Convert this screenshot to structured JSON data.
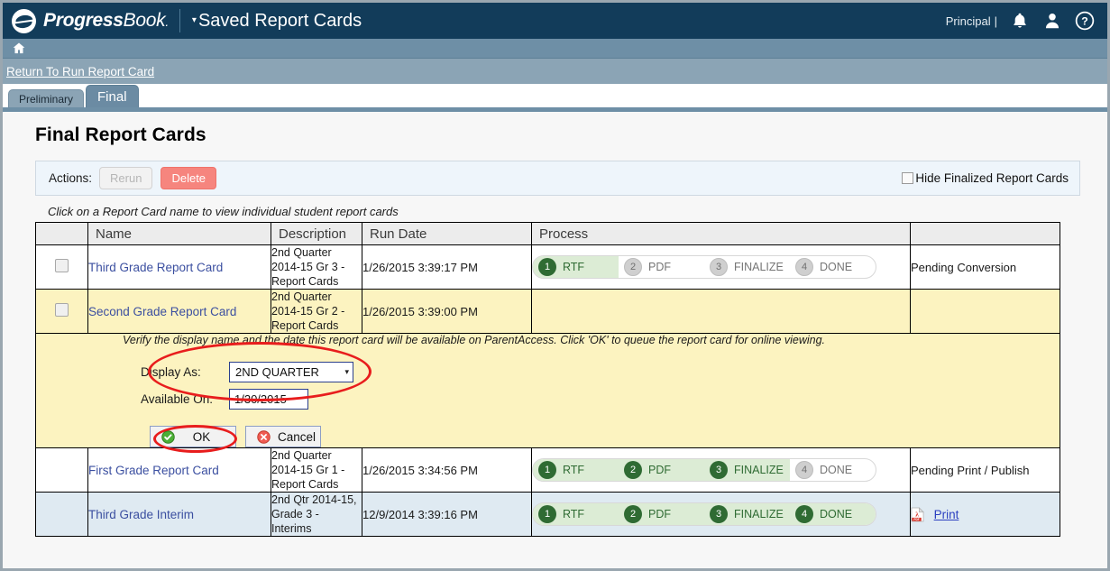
{
  "header": {
    "brand_bold": "Progress",
    "brand_light": "Book",
    "brand_dot": ".",
    "caret": "▾",
    "page_title": "Saved Report Cards",
    "user_role": "Principal",
    "separator": "|",
    "icons": {
      "bell": "bell-icon",
      "user": "user-icon",
      "help": "help-icon"
    },
    "brand_color": "#123c5a"
  },
  "nav": {
    "home_icon": "home-icon"
  },
  "returnbar": {
    "link_label": "Return To Run Report Card"
  },
  "tabs": [
    {
      "label": "Preliminary",
      "active": false
    },
    {
      "label": "Final",
      "active": true
    }
  ],
  "main": {
    "page_heading": "Final Report Cards",
    "actions_label": "Actions:",
    "rerun_label": "Rerun",
    "delete_label": "Delete",
    "hide_finalized_label": "Hide Finalized Report Cards",
    "hide_finalized_checked": false,
    "grid_hint": "Click on a Report Card name to view individual student report cards",
    "delete_color": "#f6857e",
    "link_color": "#3b4fa0"
  },
  "table": {
    "columns": [
      "",
      "Name",
      "Description",
      "Run Date",
      "Process",
      ""
    ],
    "process_steps": [
      "RTF",
      "PDF",
      "FINALIZE",
      "DONE"
    ],
    "rows": [
      {
        "checkbox": true,
        "name": "Third Grade Report Card",
        "description": "2nd Quarter 2014-15 Gr 3 - Report Cards",
        "run_date": "1/26/2015  3:39:17 PM",
        "steps_done": 1,
        "status": "Pending Conversion",
        "row_style": "white",
        "print_link": null
      },
      {
        "checkbox": true,
        "name": "Second Grade Report Card",
        "description": "2nd Quarter 2014-15 Gr 2 - Report Cards",
        "run_date": "1/26/2015  3:39:00 PM",
        "steps_done": 0,
        "status": "",
        "row_style": "yellow",
        "print_link": null
      },
      {
        "checkbox": false,
        "name": "First Grade Report Card",
        "description": "2nd Quarter 2014-15 Gr 1 - Report Cards",
        "run_date": "1/26/2015  3:34:56 PM",
        "steps_done": 3,
        "status": "Pending Print / Publish",
        "row_style": "white",
        "print_link": null
      },
      {
        "checkbox": false,
        "name": "Third Grade Interim",
        "description": "2nd Qtr 2014-15, Grade 3 - Interims",
        "run_date": "12/9/2014  3:39:16 PM",
        "steps_done": 4,
        "status": "",
        "row_style": "blue",
        "print_link": "Print"
      }
    ]
  },
  "panel": {
    "note": "Verify the display name and the date this report card will be available on ParentAccess. Click 'OK' to queue the report card for online viewing.",
    "display_as_label": "Display As:",
    "display_as_value": "2ND QUARTER",
    "display_as_caret": "▾",
    "available_on_label": "Available On:",
    "available_on_value": "1/30/2015",
    "ok_label": "OK",
    "cancel_label": "Cancel",
    "annotation_color": "#e81d1d"
  }
}
